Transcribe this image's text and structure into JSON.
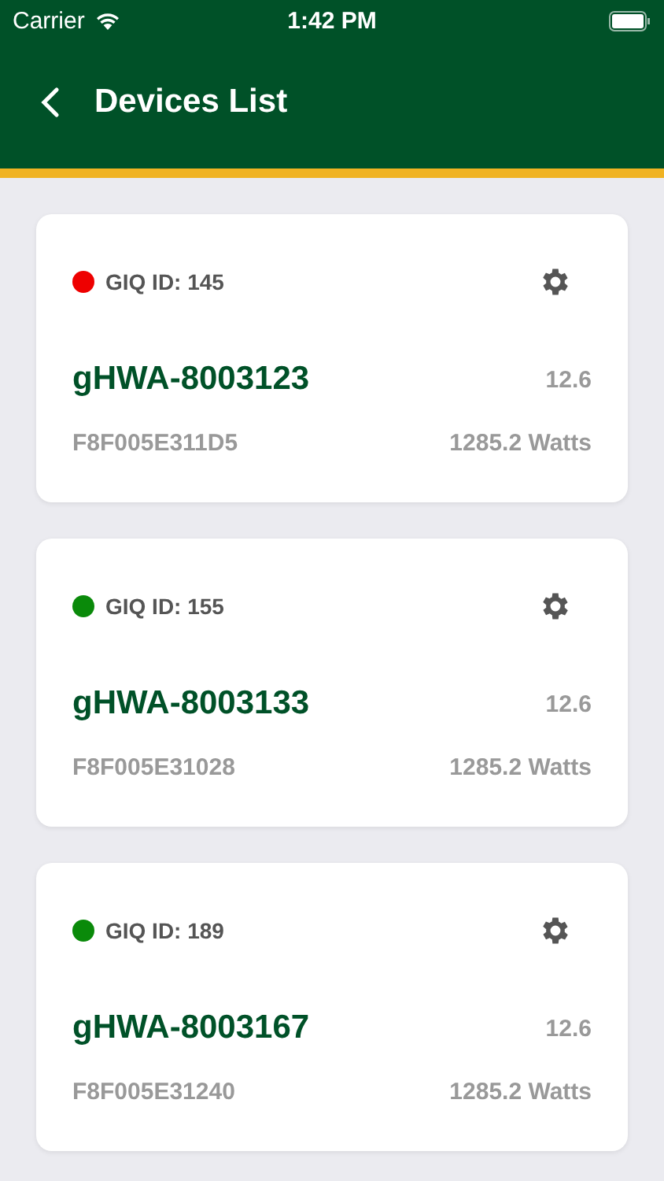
{
  "status_bar": {
    "carrier": "Carrier",
    "time": "1:42 PM"
  },
  "header": {
    "title": "Devices List"
  },
  "devices": [
    {
      "id_label": "GIQ ID: 145",
      "color": "#ee0000",
      "name": "gHWA-8003123",
      "value": "12.6",
      "mac": "F8F005E311D5",
      "power": "1285.2 Watts"
    },
    {
      "id_label": "GIQ ID: 155",
      "color": "#0a8a0a",
      "name": "gHWA-8003133",
      "value": "12.6",
      "mac": "F8F005E31028",
      "power": "1285.2 Watts"
    },
    {
      "id_label": "GIQ ID: 189",
      "color": "#0a8a0a",
      "name": "gHWA-8003167",
      "value": "12.6",
      "mac": "F8F005E31240",
      "power": "1285.2 Watts"
    }
  ]
}
